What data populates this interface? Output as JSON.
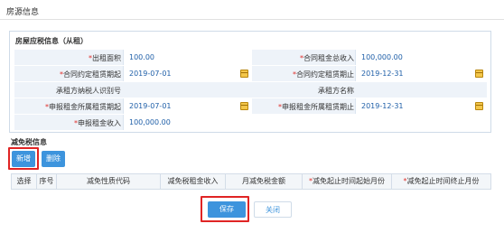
{
  "window": {
    "title": "房源信息"
  },
  "rent_info": {
    "title": "房屋应税信息（从租）",
    "fields": {
      "rent_area": {
        "label": "出租面积",
        "required": "*",
        "value": "100.00"
      },
      "contract_total_rent": {
        "label": "合同租金总收入",
        "required": "*",
        "value": "100,000.00"
      },
      "contract_start": {
        "label": "合同约定租赁期起",
        "required": "*",
        "value": "2019-07-01"
      },
      "contract_end": {
        "label": "合同约定租赁期止",
        "required": "*",
        "value": "2019-12-31"
      },
      "lessee_tax_id": {
        "label": "承租方纳税人识别号",
        "required": "",
        "value": ""
      },
      "lessee_name": {
        "label": "承租方名称",
        "required": "",
        "value": ""
      },
      "declared_start": {
        "label": "申报租金所属租赁期起",
        "required": "*",
        "value": "2019-07-01"
      },
      "declared_end": {
        "label": "申报租金所属租赁期止",
        "required": "*",
        "value": "2019-12-31"
      },
      "declared_income": {
        "label": "申报租金收入",
        "required": "*",
        "value": "100,000.00"
      }
    }
  },
  "exemption": {
    "title": "减免税信息",
    "add_label": "新增",
    "delete_label": "删除",
    "columns": [
      {
        "label": "选择",
        "required": ""
      },
      {
        "label": "序号",
        "required": ""
      },
      {
        "label": "减免性质代码",
        "required": ""
      },
      {
        "label": "减免税租金收入",
        "required": ""
      },
      {
        "label": "月减免税金额",
        "required": ""
      },
      {
        "label": "减免起止时间起始月份",
        "required": "*"
      },
      {
        "label": "减免起止时间终止月份",
        "required": "*"
      }
    ]
  },
  "footer": {
    "save_label": "保存",
    "close_label": "关闭"
  },
  "colors": {
    "primary": "#3d94dd",
    "highlight": "#e02424",
    "required": "#e0302b",
    "field_bg": "#eef3f9",
    "value_text": "#1f5fa8"
  },
  "icons": {
    "date_picker": "calendar-icon"
  }
}
